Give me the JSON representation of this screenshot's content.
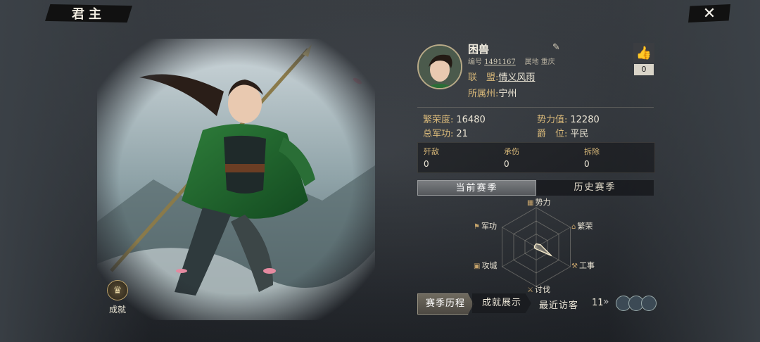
{
  "header": {
    "title": "君主",
    "close_icon": "close-icon"
  },
  "portrait": {
    "achievement_label": "成就"
  },
  "profile": {
    "name": "困兽",
    "id_label": "编号",
    "id_value": "1491167",
    "origin_label": "属地",
    "origin_value": "重庆",
    "alliance_label": "联　盟:",
    "alliance_value": "情义风雨",
    "state_label": "所属州:",
    "state_value": "宁州",
    "likes": "0"
  },
  "stats": {
    "prosperity_label": "繁荣度:",
    "prosperity_value": "16480",
    "power_label": "势力值:",
    "power_value": "12280",
    "merit_label": "总军功:",
    "merit_value": "21",
    "rank_label": "爵　位:",
    "rank_value": "平民"
  },
  "mini": [
    {
      "label": "歼敌",
      "value": "0"
    },
    {
      "label": "承伤",
      "value": "0"
    },
    {
      "label": "拆除",
      "value": "0"
    }
  ],
  "tabs": {
    "current": "当前赛季",
    "history": "历史赛季"
  },
  "radar": {
    "axes": [
      {
        "label": "势力",
        "value": 0.08
      },
      {
        "label": "繁荣",
        "value": 0.12
      },
      {
        "label": "工事",
        "value": 0.45
      },
      {
        "label": "讨伐",
        "value": 0.05
      },
      {
        "label": "攻城",
        "value": 0.05
      },
      {
        "label": "军功",
        "value": 0.05
      }
    ],
    "accent": "#f0e6c8"
  },
  "bottom": {
    "season_history": "赛季历程",
    "achievement_show": "成就展示",
    "recent_visitors": "最近访客",
    "visitor_count": "11"
  },
  "colors": {
    "label_gold": "#d8b879",
    "text": "#ece6d6"
  }
}
